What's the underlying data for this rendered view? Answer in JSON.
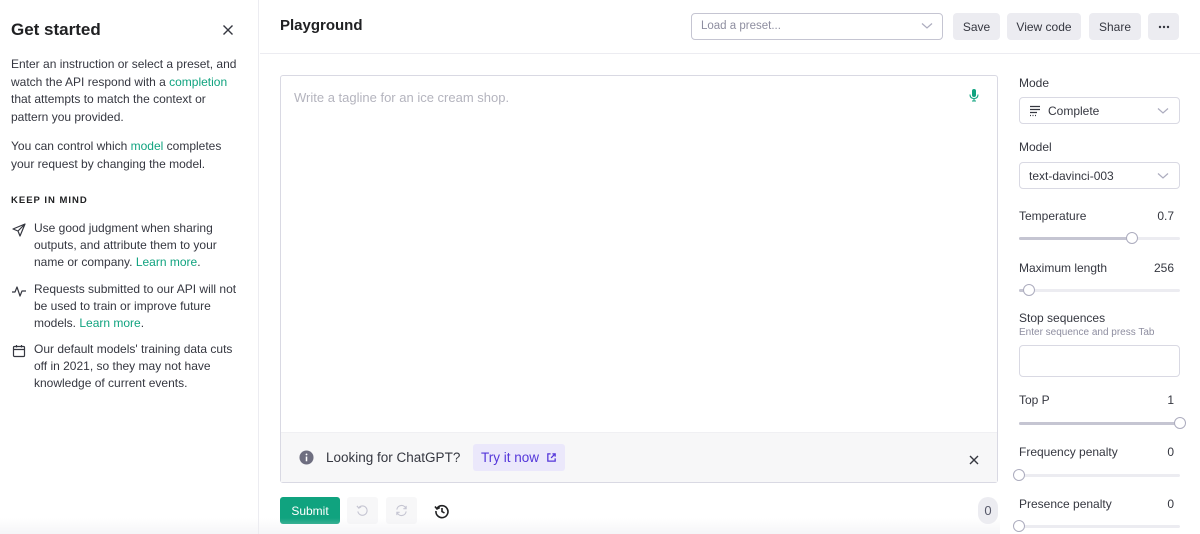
{
  "sidebar": {
    "title": "Get started",
    "intro": {
      "part1": "Enter an instruction or select a preset, and watch the API respond with a ",
      "link": "completion",
      "part2": " that attempts to match the context or pattern you provided."
    },
    "model_para": {
      "part1": "You can control which ",
      "link": "model",
      "part2": " completes your request by changing the model."
    },
    "keep_in_mind": "KEEP IN MIND",
    "items": [
      {
        "icon": "send-icon",
        "text": "Use good judgment when sharing outputs, and attribute them to your name or company. ",
        "link": "Learn more",
        "suffix": "."
      },
      {
        "icon": "activity-icon",
        "text": "Requests submitted to our API will not be used to train or improve future models. ",
        "link": "Learn more",
        "suffix": "."
      },
      {
        "icon": "calendar-icon",
        "text": "Our default models' training data cuts off in 2021, so they may not have knowledge of current events.",
        "link": "",
        "suffix": ""
      }
    ]
  },
  "header": {
    "title": "Playground",
    "preset_placeholder": "Load a preset...",
    "save": "Save",
    "view_code": "View code",
    "share": "Share",
    "more": "•••"
  },
  "editor": {
    "placeholder": "Write a tagline for an ice cream shop.",
    "value": "",
    "banner_text": "Looking for ChatGPT?",
    "banner_link": "Try it now"
  },
  "actions": {
    "submit": "Submit",
    "token_count": "0"
  },
  "panel": {
    "mode_label": "Mode",
    "mode_value": "Complete",
    "model_label": "Model",
    "model_value": "text-davinci-003",
    "temperature": {
      "label": "Temperature",
      "value": "0.7",
      "fraction": 0.7
    },
    "max_length": {
      "label": "Maximum length",
      "value": "256",
      "fraction": 0.06
    },
    "stop": {
      "label": "Stop sequences",
      "hint": "Enter sequence and press Tab",
      "value": ""
    },
    "top_p": {
      "label": "Top P",
      "value": "1",
      "fraction": 1.0
    },
    "frequency_penalty": {
      "label": "Frequency penalty",
      "value": "0",
      "fraction": 0.0
    },
    "presence_penalty": {
      "label": "Presence penalty",
      "value": "0",
      "fraction": 0.0
    }
  },
  "colors": {
    "accent": "#10a37f",
    "link_purple": "#5436da",
    "banner_link_bg": "#ebe8fb"
  }
}
